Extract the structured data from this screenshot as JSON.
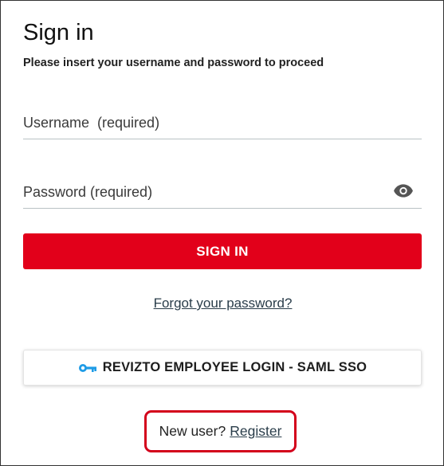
{
  "header": {
    "title": "Sign in",
    "subtitle": "Please insert your username and password to proceed"
  },
  "form": {
    "username": {
      "value": "",
      "placeholder": "Username  (required)"
    },
    "password": {
      "value": "",
      "placeholder": "Password (required)",
      "toggle_icon": "eye-icon"
    },
    "signin_label": "SIGN IN",
    "forgot_label": "Forgot your password?"
  },
  "sso": {
    "icon": "key-icon",
    "label": "REVIZTO EMPLOYEE LOGIN - SAML SSO"
  },
  "register": {
    "prompt": "New user?",
    "link_label": "Register"
  },
  "colors": {
    "accent": "#e2001a",
    "key_icon": "#1e9be6",
    "link": "#2a3d4a",
    "highlight_border": "#d3001b"
  }
}
